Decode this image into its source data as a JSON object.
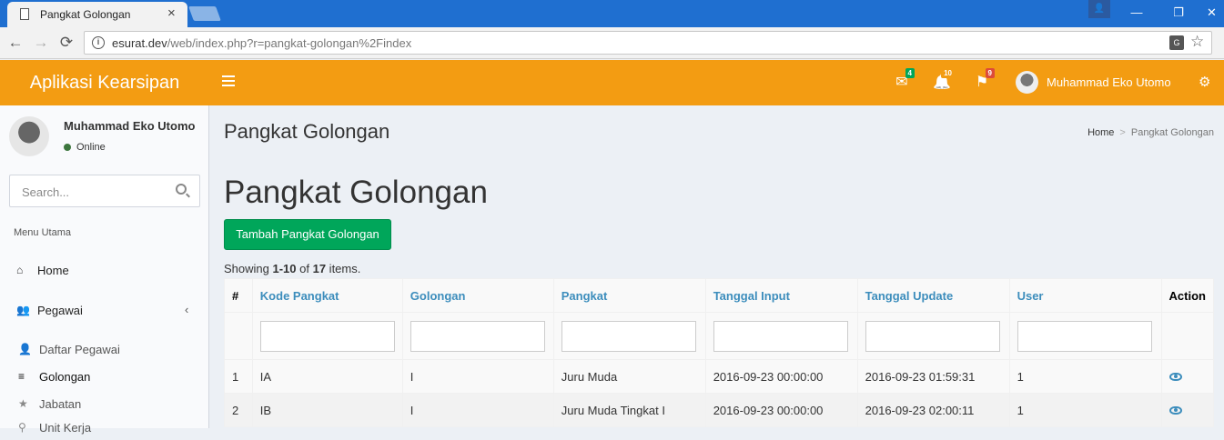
{
  "browser": {
    "tab_title": "Pangkat Golongan",
    "tab_close": "×",
    "url_main": "esurat.dev",
    "url_rest": "/web/index.php?r=pangkat-golongan%2Findex",
    "back": "←",
    "forward": "→",
    "reload": "⟳",
    "win_min": "—",
    "win_max": "❐",
    "win_close": "✕",
    "user_icon": "👤",
    "translate": "G",
    "star": "☆"
  },
  "header": {
    "logo": "Aplikasi Kearsipan",
    "mail_badge": "4",
    "bell_badge": "10",
    "flag_badge": "9",
    "mail_icon": "✉",
    "bell_icon": "🔔",
    "flag_icon": "⚑",
    "user_name": "Muhammad Eko Utomo",
    "gears_icon": "⚙",
    "badge_colors": {
      "mail": "#00a65a",
      "bell": "#f39c12",
      "flag": "#dd4b39"
    }
  },
  "sidebar": {
    "user_name": "Muhammad Eko Utomo",
    "status": "Online",
    "search_placeholder": "Search...",
    "menu_header": "Menu Utama",
    "home": "Home",
    "home_icon": "⌂",
    "pegawai": "Pegawai",
    "pegawai_icon": "👥",
    "pegawai_chevron": "‹",
    "subitems": [
      {
        "label": "Daftar Pegawai",
        "icon": "👤"
      },
      {
        "label": "Golongan",
        "icon": "≡"
      },
      {
        "label": "Jabatan",
        "icon": "★"
      },
      {
        "label": "Unit Kerja",
        "icon": "⚲"
      }
    ]
  },
  "content": {
    "page_title": "Pangkat Golongan",
    "breadcrumb": {
      "home": "Home",
      "sep": ">",
      "current": "Pangkat Golongan"
    },
    "heading": "Pangkat Golongan",
    "add_button": "Tambah Pangkat Golongan",
    "summary": {
      "prefix": "Showing ",
      "range": "1-10",
      "of": " of ",
      "total": "17",
      "suffix": " items."
    },
    "columns": [
      "#",
      "Kode Pangkat",
      "Golongan",
      "Pangkat",
      "Tanggal Input",
      "Tanggal Update",
      "User",
      "Action"
    ],
    "rows": [
      {
        "no": "1",
        "kode": "IA",
        "golongan": "I",
        "pangkat": "Juru Muda",
        "tgl_input": "2016-09-23 00:00:00",
        "tgl_update": "2016-09-23 01:59:31",
        "user": "1"
      },
      {
        "no": "2",
        "kode": "IB",
        "golongan": "I",
        "pangkat": "Juru Muda Tingkat I",
        "tgl_input": "2016-09-23 00:00:00",
        "tgl_update": "2016-09-23 02:00:11",
        "user": "1"
      }
    ]
  }
}
